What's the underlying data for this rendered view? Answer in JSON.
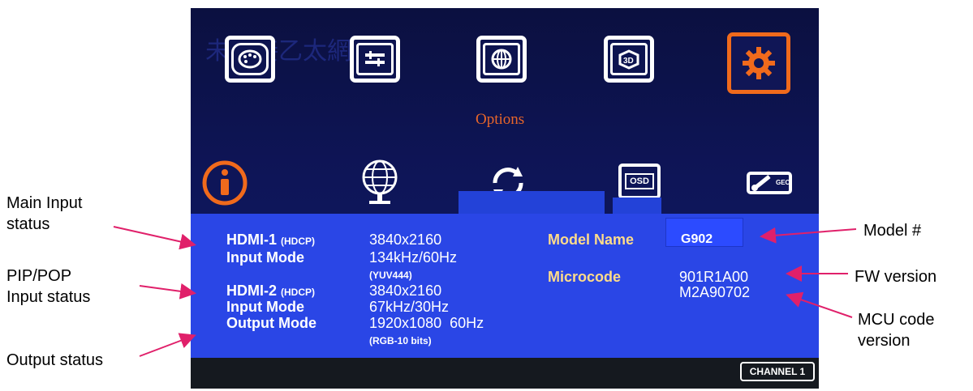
{
  "annotations": {
    "main_input": [
      "Main Input",
      "status"
    ],
    "pip_pop": [
      "PIP/POP",
      "Input status"
    ],
    "output": "Output status",
    "model": "Model #",
    "fw": "FW version",
    "mcu": [
      "MCU code",
      "version"
    ]
  },
  "osd": {
    "menu_title": "Options",
    "top_icons": [
      "palette-icon",
      "adjust-icon",
      "grid-icon",
      "3d-icon",
      "gear-icon"
    ],
    "bottom_icons": [
      "info-icon",
      "globe-icon",
      "refresh-icon",
      "osd-icon",
      "tool-icon"
    ],
    "osd_icon_text": "OSD",
    "tool_icon_text": "GEO",
    "ghost_text": "未連接乙太網路",
    "info": {
      "hdmi1_label": "HDMI-1",
      "hdmi1_hdcp": "(HDCP)",
      "hdmi1_res": "3840x2160",
      "input_mode_label": "Input Mode",
      "hdmi1_mode": "134kHz/60Hz",
      "hdmi1_color": "(YUV444)",
      "hdmi2_label": "HDMI-2",
      "hdmi2_hdcp": "(HDCP)",
      "hdmi2_res": "3840x2160",
      "input_mode2_label": "Input Mode",
      "hdmi2_mode": "67kHz/30Hz",
      "output_label": "Output Mode",
      "output_res": "1920x1080  60Hz",
      "output_color": "(RGB-10 bits)",
      "model_label": "Model Name",
      "model_value": "G902",
      "micro_label": "Microcode",
      "fw_version": "901R1A00",
      "mcu_version": "M2A90702"
    },
    "channel": "CHANNEL 1"
  },
  "colors": {
    "selected": "#f06a1c",
    "arrow": "#e0206a",
    "panel": "#2a46e6"
  }
}
